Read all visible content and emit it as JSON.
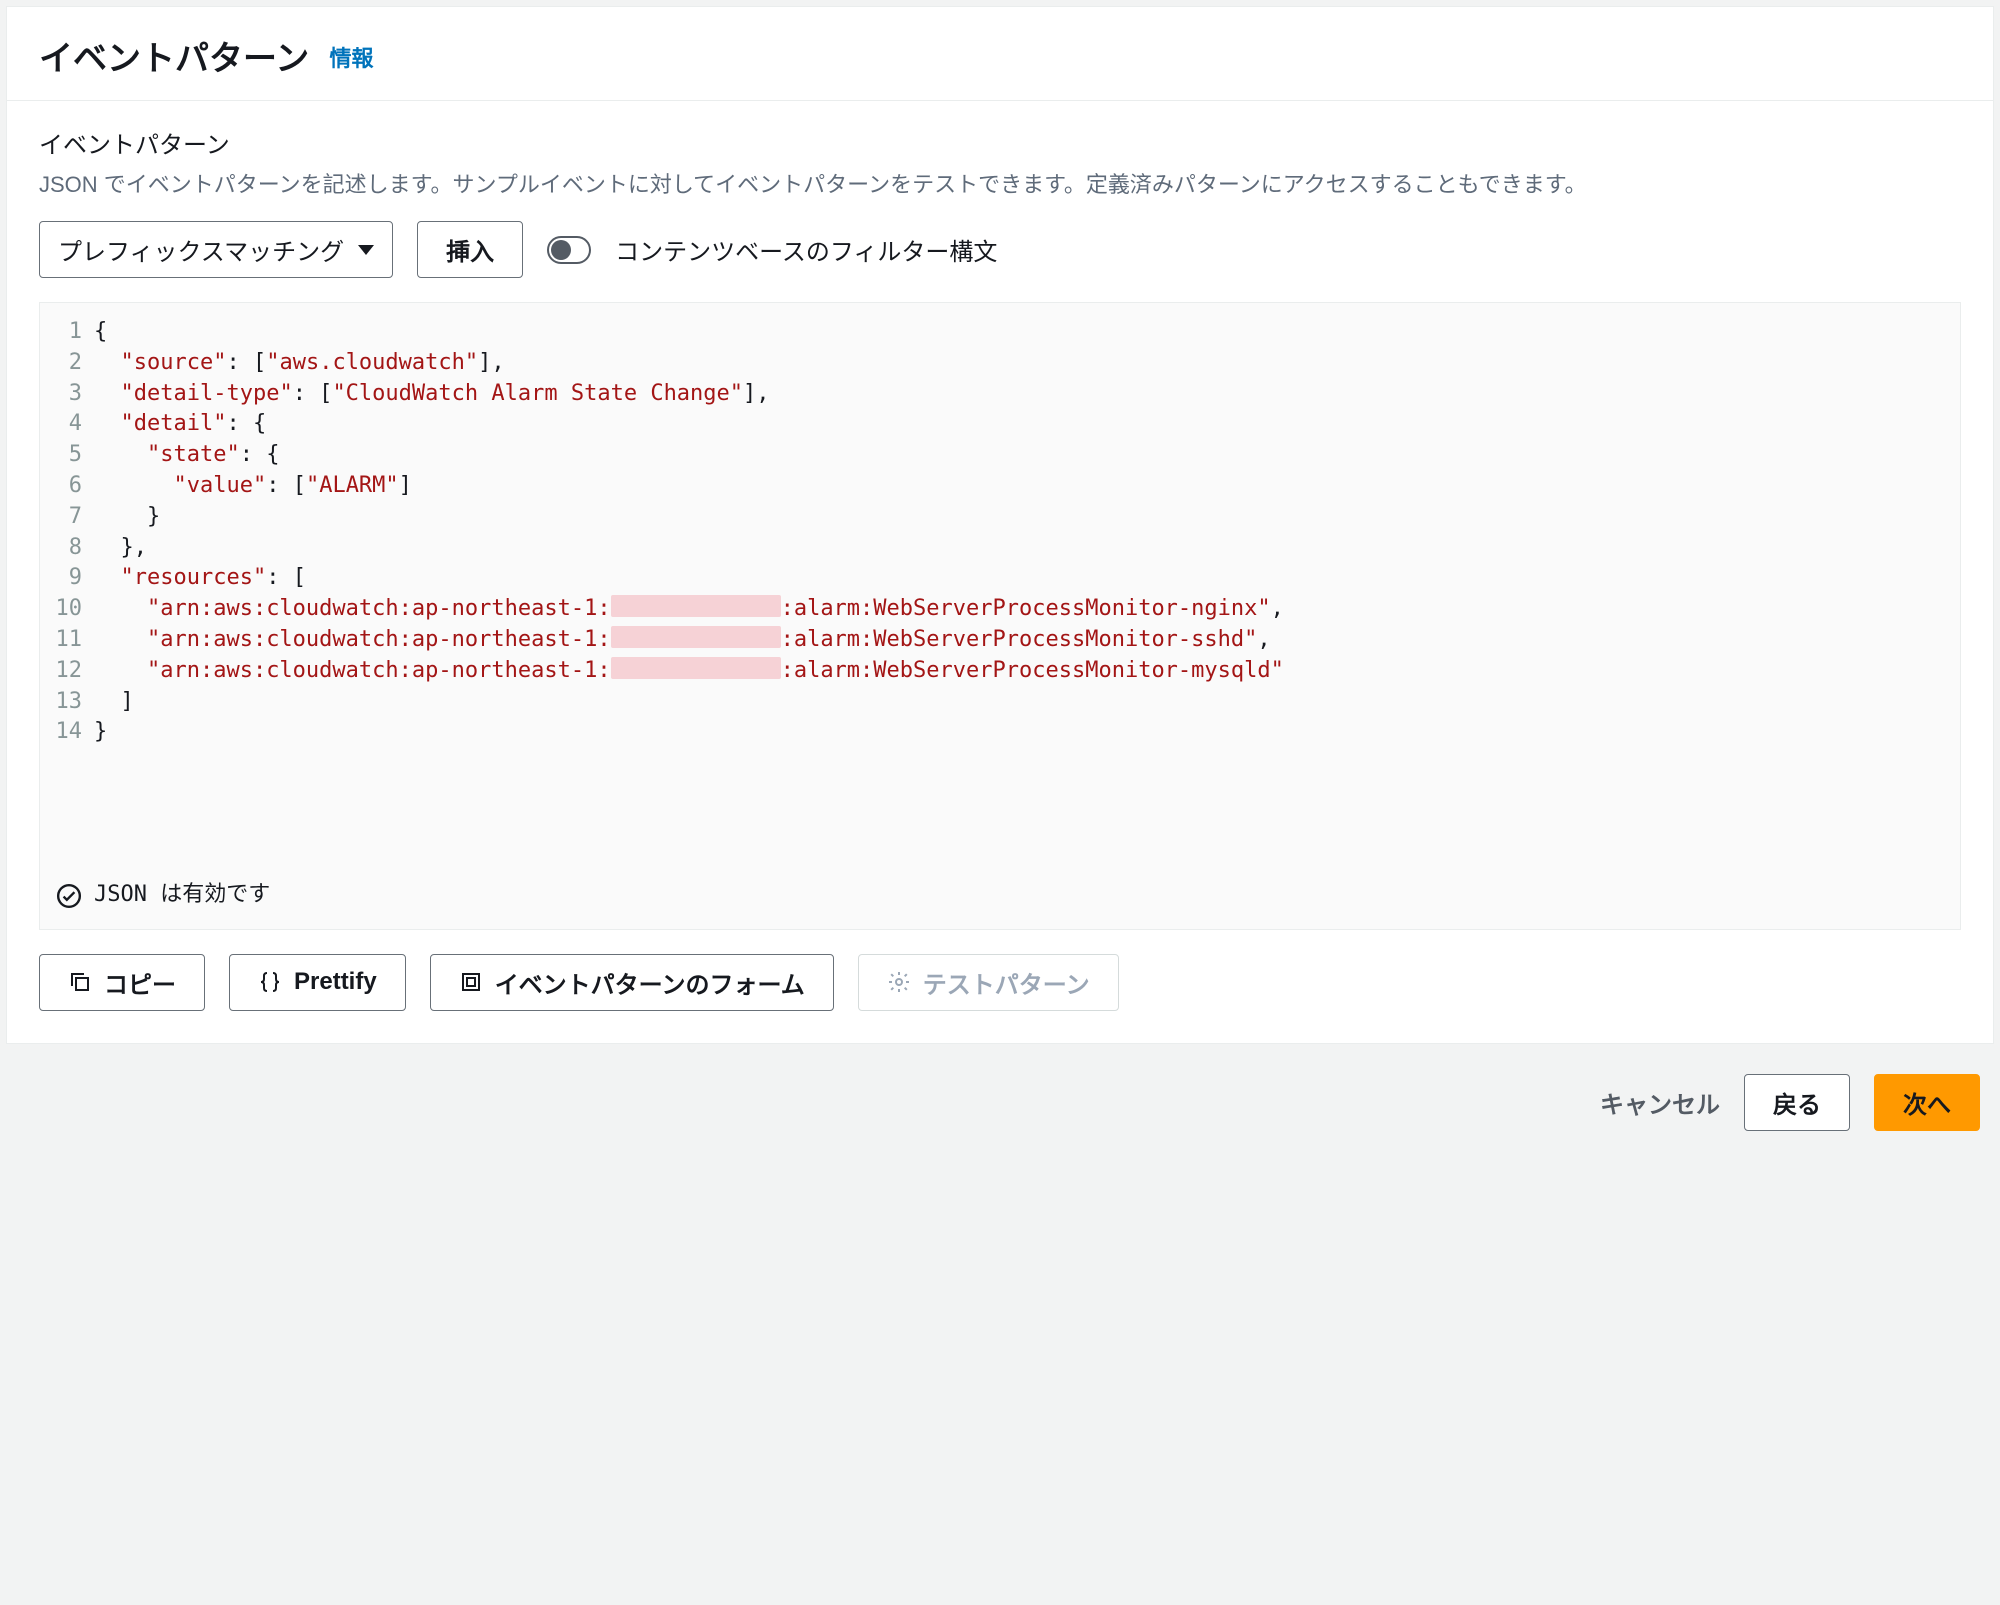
{
  "header": {
    "title": "イベントパターン",
    "info_link": "情報"
  },
  "section": {
    "title": "イベントパターン",
    "description": "JSON でイベントパターンを記述します。サンプルイベントに対してイベントパターンをテストできます。定義済みパターンにアクセスすることもできます。"
  },
  "controls": {
    "dropdown": "プレフィックスマッチング",
    "insert_button": "挿入",
    "toggle_label": "コンテンツベースのフィルター構文",
    "toggle_state": false
  },
  "editor": {
    "line_numbers": [
      "1",
      "2",
      "3",
      "4",
      "5",
      "6",
      "7",
      "8",
      "9",
      "10",
      "11",
      "12",
      "13",
      "14"
    ],
    "json": {
      "source": [
        "aws.cloudwatch"
      ],
      "detail-type": [
        "CloudWatch Alarm State Change"
      ],
      "detail": {
        "state": {
          "value": [
            "ALARM"
          ]
        }
      },
      "resources": [
        "arn:aws:cloudwatch:ap-northeast-1:<redacted>:alarm:WebServerProcessMonitor-nginx",
        "arn:aws:cloudwatch:ap-northeast-1:<redacted>:alarm:WebServerProcessMonitor-sshd",
        "arn:aws:cloudwatch:ap-northeast-1:<redacted>:alarm:WebServerProcessMonitor-mysqld"
      ]
    },
    "status": "JSON は有効です"
  },
  "action_buttons": {
    "copy": "コピー",
    "prettify": "Prettify",
    "form": "イベントパターンのフォーム",
    "test": "テストパターン"
  },
  "footer": {
    "cancel": "キャンセル",
    "back": "戻る",
    "next": "次へ"
  }
}
